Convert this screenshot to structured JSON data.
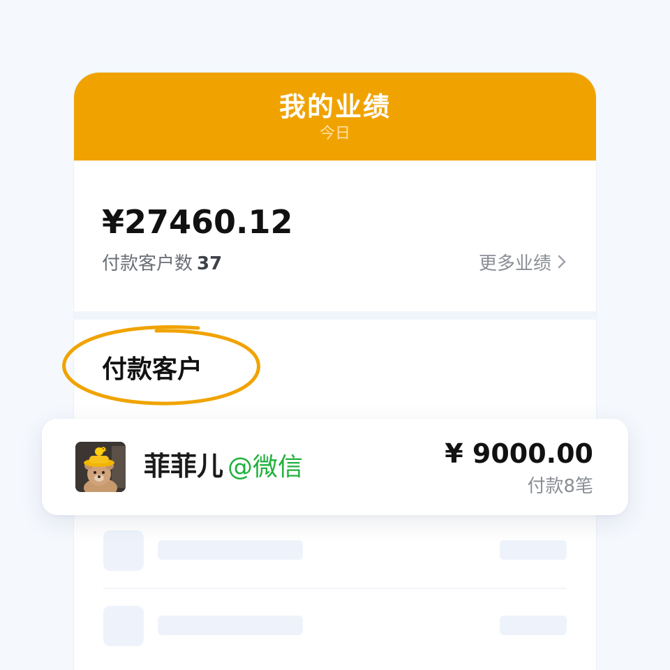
{
  "header": {
    "title": "我的业绩",
    "subtitle": "今日"
  },
  "summary": {
    "amount": "¥27460.12",
    "customers_label": "付款客户数",
    "customers_count": "37",
    "more_label": "更多业绩"
  },
  "section": {
    "title": "付款客户"
  },
  "featured_customer": {
    "name": "菲菲儿",
    "channel": "@微信",
    "amount": "¥ 9000.00",
    "detail": "付款8笔"
  },
  "colors": {
    "accent": "#f0a300",
    "channel": "#1fb13c",
    "skeleton": "#eef3fb"
  },
  "icons": {
    "more": "chevron-right-icon",
    "highlight": "circle-highlight"
  }
}
